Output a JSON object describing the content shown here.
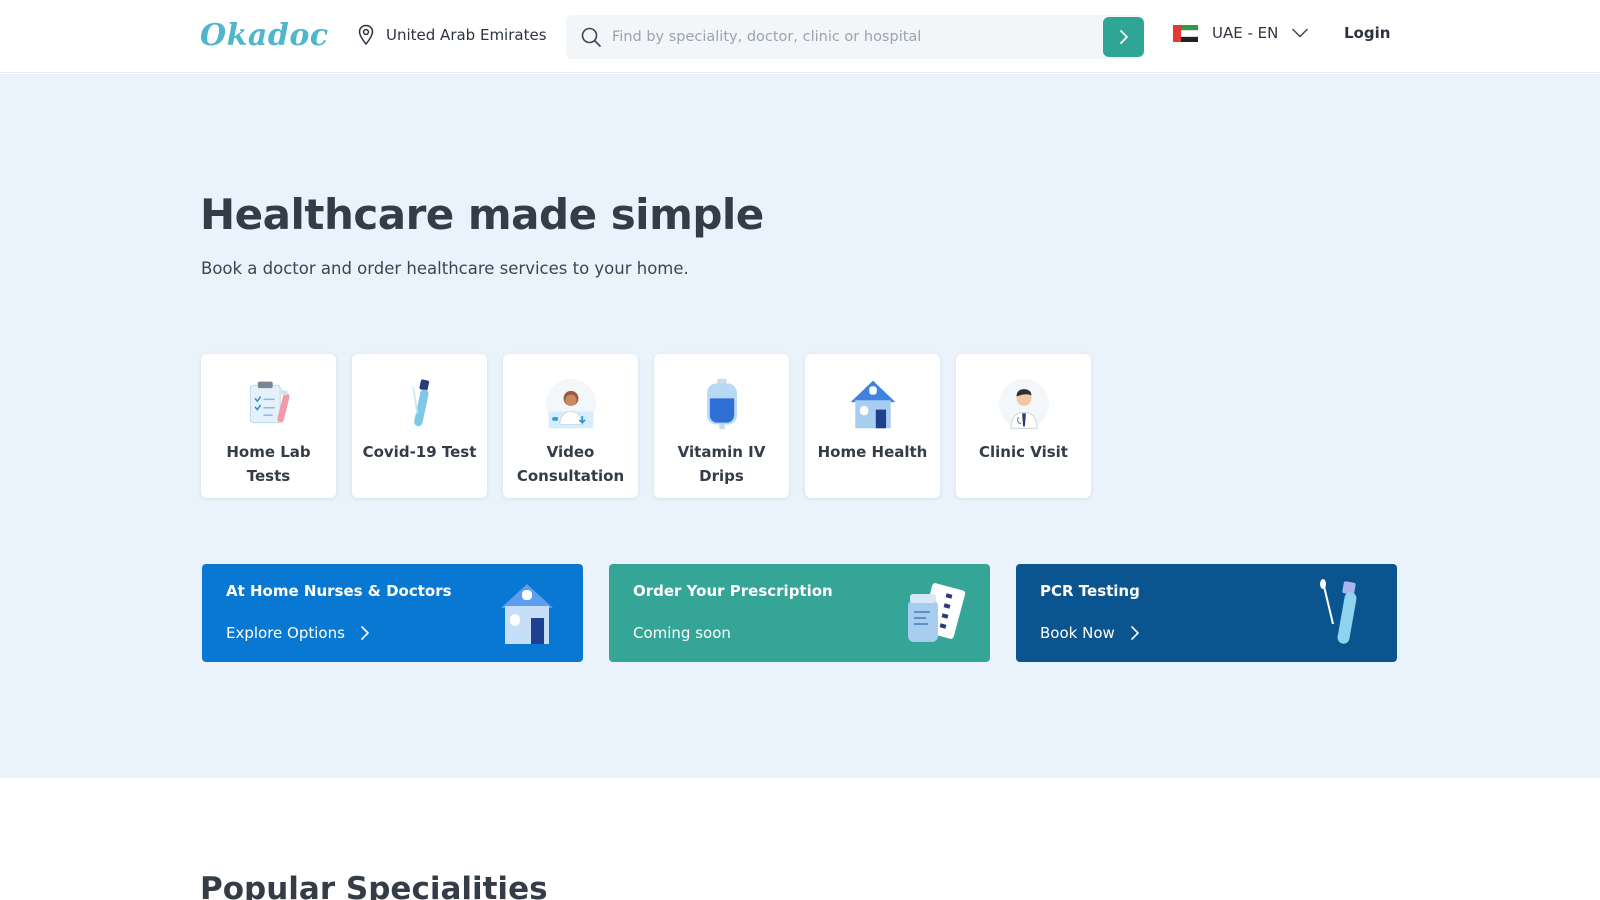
{
  "header": {
    "logo": "Okadoc",
    "location": "United Arab Emirates",
    "search_placeholder": "Find by speciality, doctor, clinic or hospital",
    "language": "UAE - EN",
    "login": "Login"
  },
  "hero": {
    "title": "Healthcare made simple",
    "subtitle": "Book a doctor and order healthcare services to your home."
  },
  "services": [
    {
      "label": "Home Lab Tests",
      "icon": "clipboard-test-icon"
    },
    {
      "label": "Covid-19 Test",
      "icon": "swab-tube-icon"
    },
    {
      "label": "Video Consultation",
      "icon": "doctor-video-icon"
    },
    {
      "label": "Vitamin IV Drips",
      "icon": "iv-bag-icon"
    },
    {
      "label": "Home Health",
      "icon": "house-icon"
    },
    {
      "label": "Clinic Visit",
      "icon": "doctor-icon"
    }
  ],
  "promos": [
    {
      "title": "At Home Nurses & Doctors",
      "cta": "Explore Options",
      "color": "#0978d2",
      "icon": "house-icon"
    },
    {
      "title": "Order Your Prescription",
      "cta": "Coming soon",
      "color": "#34a596",
      "icon": "prescription-icon"
    },
    {
      "title": "PCR Testing",
      "cta": "Book Now",
      "color": "#0a5590",
      "icon": "swab-tube-icon"
    }
  ],
  "section": {
    "title": "Popular Specialities"
  },
  "colors": {
    "accent": "#2fa596",
    "hero_bg": "#eaf3fb",
    "logo": "#4fb7c9"
  }
}
